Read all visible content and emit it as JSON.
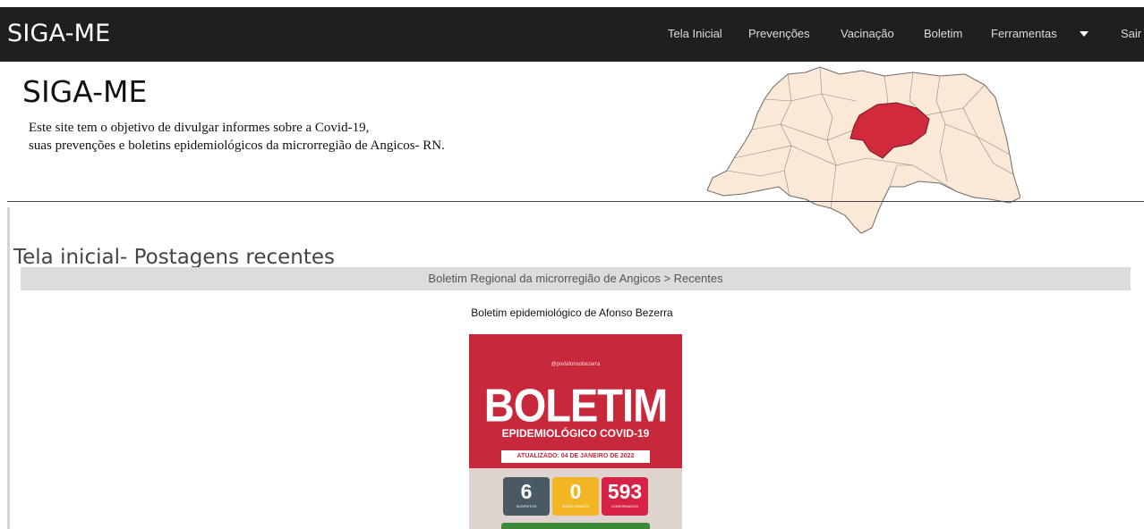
{
  "navbar": {
    "brand": "SIGA-ME",
    "items": [
      "Tela Inicial",
      "Prevenções",
      "Vacinação",
      "Boletim",
      "Ferramentas",
      "Sair"
    ]
  },
  "header": {
    "title": "SIGA-ME",
    "description_line1": "Este site tem o objetivo de divulgar informes sobre a Covid-19,",
    "description_line2": "suas prevenções e boletins epidemiológicos da microrregião de Angicos- RN."
  },
  "section": {
    "title": "Tela inicial- Postagens recentes",
    "breadcrumb": "Boletim Regional da microrregião de Angicos > Recentes"
  },
  "post": {
    "title": "Boletim epidemiológico de Afonso Bezerra",
    "image": {
      "social_handle": "@prefafonsobezerra",
      "heading": "BOLETIM",
      "subheading": "EPIDEMIOLÓGICO COVID-19",
      "updated": "ATUALIZADO:  04 DE JANEIRO DE 2022",
      "stats": [
        {
          "value": "6",
          "label": "SUSPEITOS",
          "color": "#4a5a62"
        },
        {
          "value": "0",
          "label": "MONITORADOS",
          "color": "#f2b523"
        },
        {
          "value": "593",
          "label": "CONFIRMADOS",
          "color": "#d62244"
        }
      ]
    }
  },
  "colors": {
    "navbar_bg": "#1f1f1f",
    "map_fill": "#fbe8d6",
    "map_highlight": "#d12a3c",
    "poster_red": "#c8283b"
  }
}
